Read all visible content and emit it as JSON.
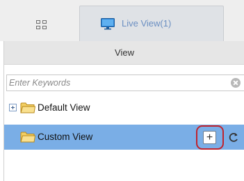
{
  "tabs": {
    "grid_icon": "grid-icon",
    "live_view": {
      "label": "Live View(1)",
      "icon": "monitor-icon"
    }
  },
  "panel": {
    "title": "View",
    "search": {
      "placeholder": "Enter Keywords",
      "value": ""
    },
    "tree": [
      {
        "label": "Default View",
        "expanded": false,
        "selected": false,
        "icon": "folder-icon"
      },
      {
        "label": "Custom View",
        "selected": true,
        "icon": "folder-icon",
        "actions": [
          {
            "name": "add",
            "label": "+"
          },
          {
            "name": "refresh",
            "icon": "refresh-icon"
          }
        ]
      }
    ]
  },
  "colors": {
    "selected_row": "#7aaee6",
    "highlight_ring": "#c0232d",
    "tab_text": "#6b8fc2"
  }
}
